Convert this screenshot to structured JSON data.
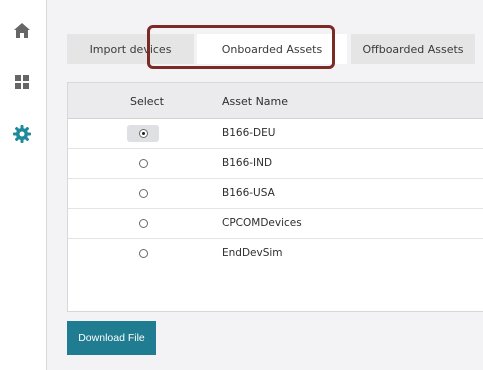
{
  "sidebar": {
    "items": [
      {
        "icon": "home-icon"
      },
      {
        "icon": "dashboard-icon"
      },
      {
        "icon": "gear-icon"
      }
    ],
    "icon_color": "#666666",
    "active_icon_color": "#1f8a99"
  },
  "tabs": [
    {
      "label": "Import devices"
    },
    {
      "label": "Onboarded Assets"
    },
    {
      "label": "Offboarded Assets"
    }
  ],
  "active_tab": "Onboarded Assets",
  "highlight_color": "#7b2a25",
  "table": {
    "columns": [
      "Select",
      "Asset Name"
    ],
    "rows": [
      {
        "asset_name": "B166-DEU",
        "selected": true
      },
      {
        "asset_name": "B166-IND",
        "selected": false
      },
      {
        "asset_name": "B166-USA",
        "selected": false
      },
      {
        "asset_name": "CPCOMDevices",
        "selected": false
      },
      {
        "asset_name": "EndDevSim",
        "selected": false
      }
    ]
  },
  "actions": {
    "download_label": "Download File"
  },
  "colors": {
    "primary_button": "#1f7c91"
  }
}
